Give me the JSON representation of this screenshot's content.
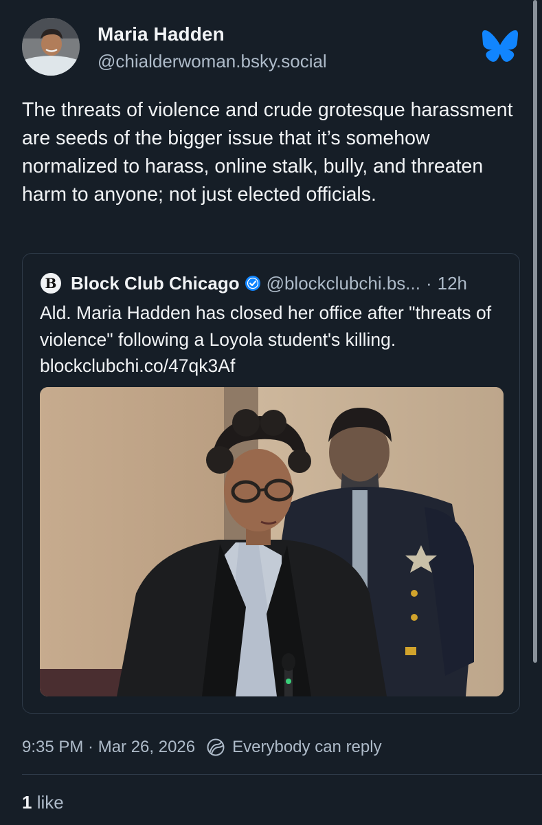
{
  "post": {
    "author_name": "Maria Hadden",
    "author_handle": "@chialderwoman.bsky.social",
    "text": "The threats of violence and crude grotesque harassment are seeds of the bigger issue that it’s somehow normalized to harass, online stalk, bully, and threaten harm to anyone; not just elected officials.",
    "timestamp": "9:35 PM · Mar 26, 2026",
    "reply_setting": "Everybody can reply",
    "likes_count": "1",
    "likes_label": "like"
  },
  "quote": {
    "avatar_letter": "B",
    "author_name": "Block Club Chicago",
    "author_handle": "@blockclubchi.bs...",
    "separator": "·",
    "time": "12h",
    "text": "Ald. Maria Hadden has closed her office after \"threats of violence\" following a Loyola student's killing. blockclubchi.co/47qk3Af"
  },
  "icons": {
    "logo": "bluesky-butterfly-icon",
    "verified": "verified-check-icon",
    "reply": "reply-settings-icon"
  },
  "colors": {
    "background": "#161e27",
    "accent": "#1185fe",
    "text_primary": "#f1f3f5",
    "text_secondary": "#aebbc9",
    "border": "#2e3a48"
  }
}
